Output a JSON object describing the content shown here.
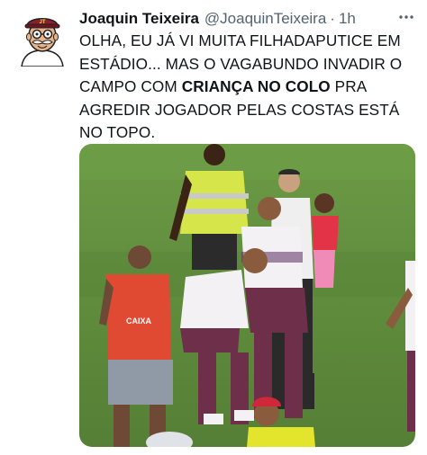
{
  "tweet": {
    "author_name": "Joaquin Teixeira",
    "handle": "@JoaquinTeixeira",
    "separator": "·",
    "time": "1h",
    "text_before": "OLHA, EU JÁ VI MUITA FILHADAPUTICE EM ESTÁDIO... MAS O VAGABUNDO INVADIR O CAMPO COM ",
    "text_bold": "CRIANÇA NO COLO",
    "text_after": " PRA AGREDIR JOGADOR PELAS COSTAS ESTÁ NO TOPO.",
    "more_icon": "more-horizontal-icon",
    "avatar_icon": "cartoon-avatar",
    "avatar_cap_text": "JT"
  },
  "media": {
    "kind": "photo",
    "description_icon": "stadium-photo",
    "sponsor_text": "CAIXA"
  },
  "colors": {
    "text": "#0f1419",
    "secondary": "#536471",
    "grass": "#5f8a3c",
    "steward_vest": "#d6e64a",
    "player_shirt": "#f3f1f3",
    "player_shorts": "#6e2f4a",
    "red_bib": "#e04a32"
  }
}
